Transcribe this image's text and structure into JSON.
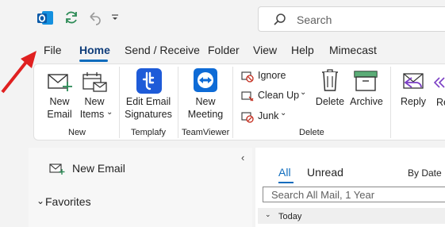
{
  "titlebar": {
    "search_placeholder": "Search"
  },
  "tabs": [
    "File",
    "Home",
    "Send / Receive",
    "Folder",
    "View",
    "Help",
    "Mimecast"
  ],
  "ribbon": {
    "new_email": [
      "New",
      "Email"
    ],
    "new_items": [
      "New",
      "Items"
    ],
    "group_new": "New",
    "edit_sig": [
      "Edit Email",
      "Signatures"
    ],
    "group_templafy": "Templafy",
    "new_meeting": [
      "New",
      "Meeting"
    ],
    "group_teamviewer": "TeamViewer",
    "ignore": "Ignore",
    "clean_up": "Clean Up",
    "junk": "Junk",
    "delete": "Delete",
    "archive": "Archive",
    "group_delete": "Delete",
    "reply": "Reply",
    "reply_all_partial": "Re"
  },
  "nav": {
    "new_email": "New Email",
    "favorites": "Favorites"
  },
  "list": {
    "tab_all": "All",
    "tab_unread": "Unread",
    "sort": "By Date",
    "search_placeholder": "Search All Mail, 1 Year",
    "group_today": "Today"
  },
  "colors": {
    "accent": "#0f6cbd",
    "arrow": "#e02020"
  }
}
